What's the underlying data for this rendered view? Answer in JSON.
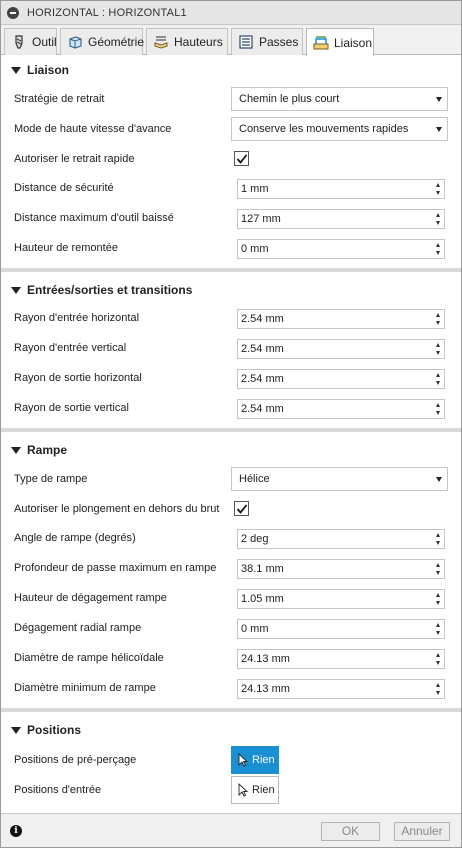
{
  "window": {
    "title": "HORIZONTAL : HORIZONTAL1"
  },
  "tabs": [
    {
      "label": "Outil",
      "icon": "tool-icon"
    },
    {
      "label": "Géométrie",
      "icon": "geometry-cube-icon"
    },
    {
      "label": "Hauteurs",
      "icon": "heights-icon"
    },
    {
      "label": "Passes",
      "icon": "passes-icon"
    },
    {
      "label": "Liaison",
      "icon": "linking-icon",
      "active": true
    }
  ],
  "sections": {
    "liaison": {
      "title": "Liaison",
      "strategie_label": "Stratégie de retrait",
      "strategie_value": "Chemin le plus court",
      "mode_label": "Mode de haute vitesse d'avance",
      "mode_value": "Conserve les mouvements rapides",
      "retrait_rapide_label": "Autoriser le retrait rapide",
      "retrait_rapide_checked": true,
      "distance_securite_label": "Distance de sécurité",
      "distance_securite_value": "1 mm",
      "distance_max_label": "Distance maximum d'outil baissé",
      "distance_max_value": "127 mm",
      "hauteur_remontee_label": "Hauteur de remontée",
      "hauteur_remontee_value": "0 mm"
    },
    "entrees": {
      "title": "Entrées/sorties et transitions",
      "rayon_entree_h_label": "Rayon d'entrée horizontal",
      "rayon_entree_h_value": "2.54 mm",
      "rayon_entree_v_label": "Rayon d'entrée vertical",
      "rayon_entree_v_value": "2.54 mm",
      "rayon_sortie_h_label": "Rayon de sortie horizontal",
      "rayon_sortie_h_value": "2.54 mm",
      "rayon_sortie_v_label": "Rayon de sortie vertical",
      "rayon_sortie_v_value": "2.54 mm"
    },
    "rampe": {
      "title": "Rampe",
      "type_label": "Type de rampe",
      "type_value": "Hélice",
      "plongement_label": "Autoriser le plongement en dehors du brut",
      "plongement_checked": true,
      "angle_label": "Angle de rampe (degrés)",
      "angle_value": "2 deg",
      "profondeur_label": "Profondeur de passe maximum en rampe",
      "profondeur_value": "38.1 mm",
      "hauteur_degagement_label": "Hauteur de dégagement rampe",
      "hauteur_degagement_value": "1.05 mm",
      "degagement_radial_label": "Dégagement radial rampe",
      "degagement_radial_value": "0 mm",
      "diametre_helico_label": "Diamètre de rampe hélicoïdale",
      "diametre_helico_value": "24.13 mm",
      "diametre_min_label": "Diamètre minimum de rampe",
      "diametre_min_value": "24.13 mm"
    },
    "positions": {
      "title": "Positions",
      "pre_percage_label": "Positions de pré-perçage",
      "pre_percage_button": "Rien",
      "entree_label": "Positions d'entrée",
      "entree_button": "Rien"
    }
  },
  "footer": {
    "ok_label": "OK",
    "cancel_label": "Annuler"
  },
  "colors": {
    "accent": "#1a8fd2",
    "separator": "#d9d9d9",
    "titlebar": "#e6e6e6"
  }
}
